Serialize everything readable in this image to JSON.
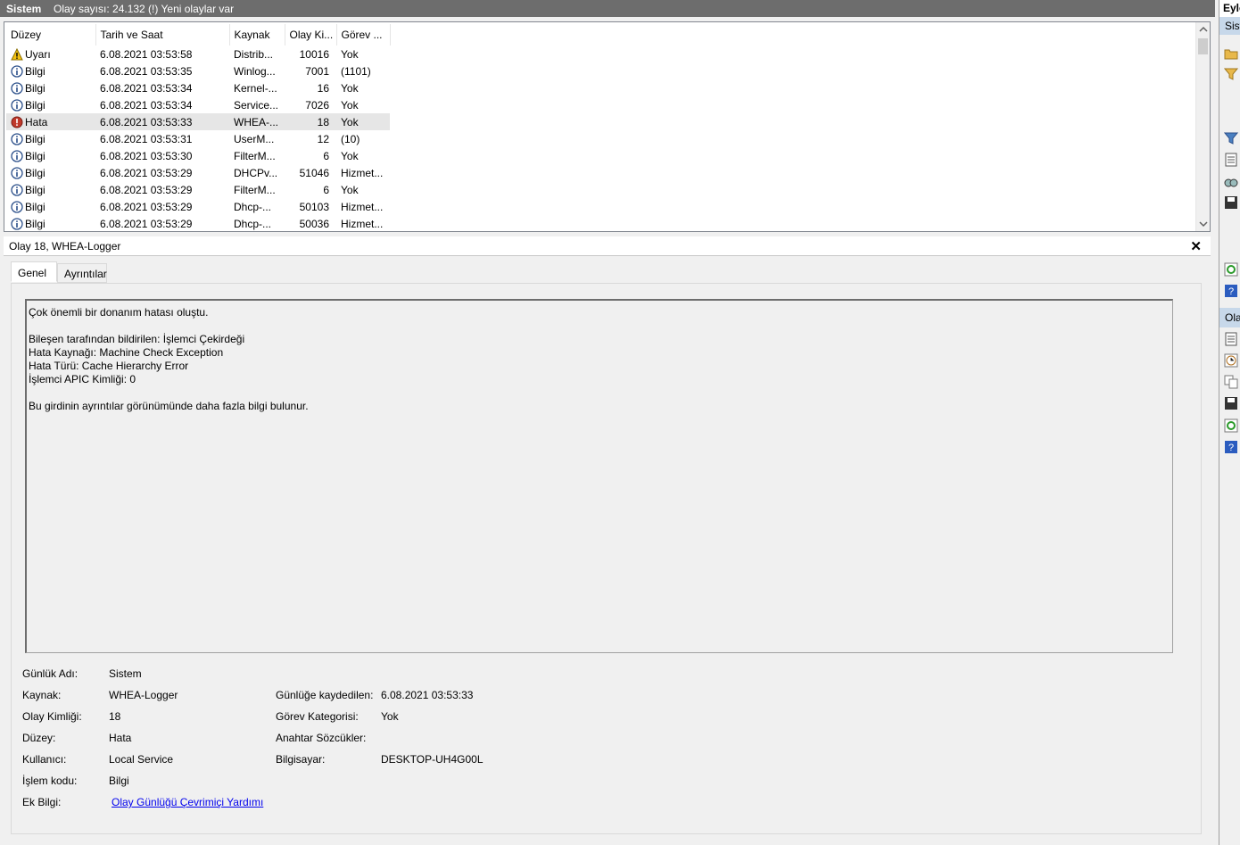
{
  "header": {
    "title": "Sistem",
    "count_text": "Olay sayısı: 24.132 (!) Yeni olaylar var"
  },
  "actions_pane": {
    "title": "Eyle",
    "section1": "Sist",
    "section2": "Ola"
  },
  "list": {
    "columns": [
      "Düzey",
      "Tarih ve Saat",
      "Kaynak",
      "Olay Ki...",
      "Görev ..."
    ],
    "rows": [
      {
        "level": "Uyarı",
        "icon": "warning-icon",
        "date": "6.08.2021 03:53:58",
        "source": "Distrib...",
        "id": "10016",
        "task": "Yok"
      },
      {
        "level": "Bilgi",
        "icon": "info-icon",
        "date": "6.08.2021 03:53:35",
        "source": "Winlog...",
        "id": "7001",
        "task": "(1101)"
      },
      {
        "level": "Bilgi",
        "icon": "info-icon",
        "date": "6.08.2021 03:53:34",
        "source": "Kernel-...",
        "id": "16",
        "task": "Yok"
      },
      {
        "level": "Bilgi",
        "icon": "info-icon",
        "date": "6.08.2021 03:53:34",
        "source": "Service...",
        "id": "7026",
        "task": "Yok"
      },
      {
        "level": "Hata",
        "icon": "error-icon",
        "date": "6.08.2021 03:53:33",
        "source": "WHEA-...",
        "id": "18",
        "task": "Yok",
        "selected": true
      },
      {
        "level": "Bilgi",
        "icon": "info-icon",
        "date": "6.08.2021 03:53:31",
        "source": "UserM...",
        "id": "12",
        "task": "(10)"
      },
      {
        "level": "Bilgi",
        "icon": "info-icon",
        "date": "6.08.2021 03:53:30",
        "source": "FilterM...",
        "id": "6",
        "task": "Yok"
      },
      {
        "level": "Bilgi",
        "icon": "info-icon",
        "date": "6.08.2021 03:53:29",
        "source": "DHCPv...",
        "id": "51046",
        "task": "Hizmet..."
      },
      {
        "level": "Bilgi",
        "icon": "info-icon",
        "date": "6.08.2021 03:53:29",
        "source": "FilterM...",
        "id": "6",
        "task": "Yok"
      },
      {
        "level": "Bilgi",
        "icon": "info-icon",
        "date": "6.08.2021 03:53:29",
        "source": "Dhcp-...",
        "id": "50103",
        "task": "Hizmet..."
      },
      {
        "level": "Bilgi",
        "icon": "info-icon",
        "date": "6.08.2021 03:53:29",
        "source": "Dhcp-...",
        "id": "50036",
        "task": "Hizmet..."
      }
    ]
  },
  "detail": {
    "title": "Olay 18, WHEA-Logger",
    "tabs": [
      "Genel",
      "Ayrıntılar"
    ],
    "message": [
      "Çok önemli bir donanım hatası oluştu.",
      "",
      "Bileşen tarafından bildirilen: İşlemci Çekirdeği",
      "Hata Kaynağı: Machine Check Exception",
      "Hata Türü: Cache Hierarchy Error",
      "İşlemci APIC Kimliği: 0",
      "",
      "Bu girdinin ayrıntılar görünümünde daha fazla bilgi bulunur."
    ],
    "fields": {
      "log_name_label": "Günlük Adı:",
      "log_name": "Sistem",
      "source_label": "Kaynak:",
      "source": "WHEA-Logger",
      "logged_label": "Günlüğe kaydedilen:",
      "logged": "6.08.2021 03:53:33",
      "event_id_label": "Olay Kimliği:",
      "event_id": "18",
      "task_cat_label": "Görev Kategorisi:",
      "task_cat": "Yok",
      "level_label": "Düzey:",
      "level": "Hata",
      "keywords_label": "Anahtar Sözcükler:",
      "user_label": "Kullanıcı:",
      "user": "Local Service",
      "computer_label": "Bilgisayar:",
      "computer": "DESKTOP-UH4G00L",
      "opcode_label": "İşlem kodu:",
      "opcode": "Bilgi",
      "more_info_label": "Ek Bilgi:",
      "more_info_link": "Olay Günlüğü Çevrimiçi Yardımı"
    }
  },
  "colors": {
    "header_bg": "#6d6d6d",
    "selected_row": "#e6e6e6",
    "link": "#0000ee",
    "error": "#c0392b",
    "warning": "#f4c20d",
    "info": "#2b4f8a"
  }
}
